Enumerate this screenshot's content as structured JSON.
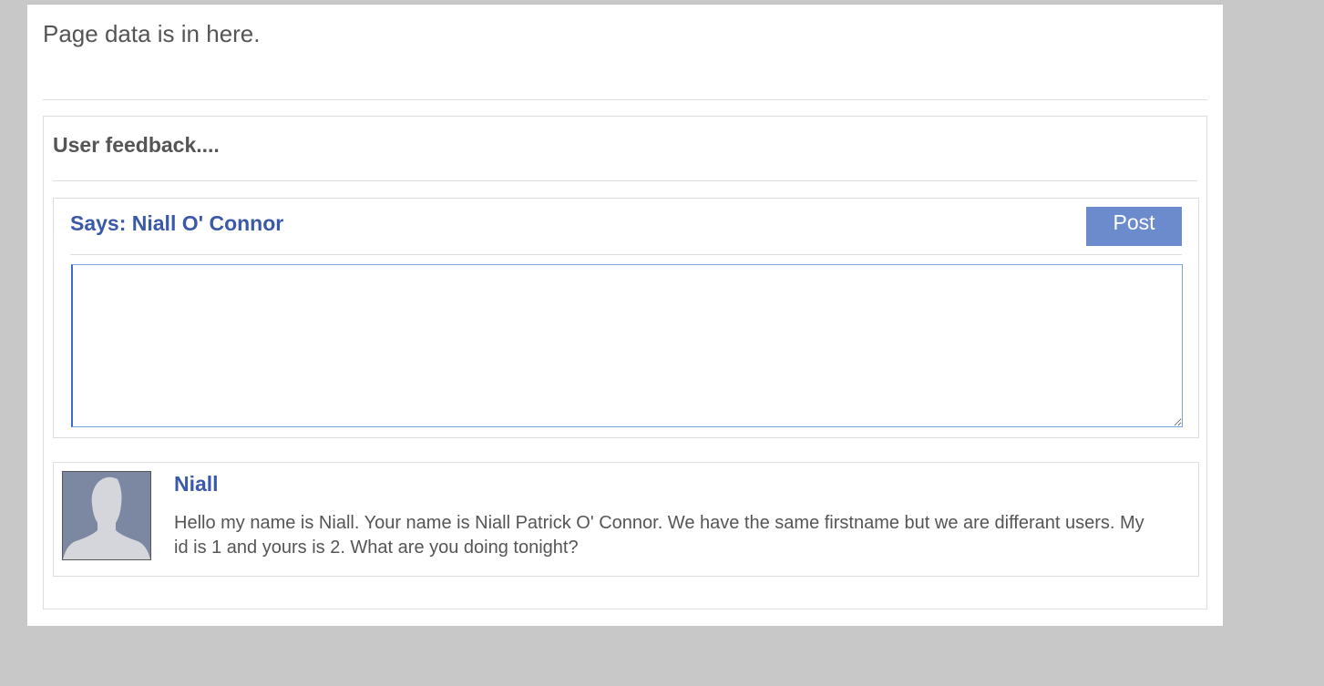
{
  "page": {
    "title": "Page data is in here."
  },
  "feedback": {
    "heading": "User feedback....",
    "compose": {
      "says_label": "Says:",
      "user_name": "Niall O' Connor",
      "post_label": "Post",
      "textarea_value": ""
    },
    "comments": [
      {
        "author": "Niall",
        "text": "Hello my name is Niall. Your name is Niall Patrick O' Connor. We have the same firstname but we are differant users. My id is 1 and yours is 2. What are you doing tonight?",
        "avatar_icon": "default-user-avatar-icon"
      }
    ]
  },
  "colors": {
    "background": "#c8c8c8",
    "link_blue": "#3a59a8",
    "button_blue": "#6c8bcc",
    "avatar_bg": "#7c87a2"
  }
}
